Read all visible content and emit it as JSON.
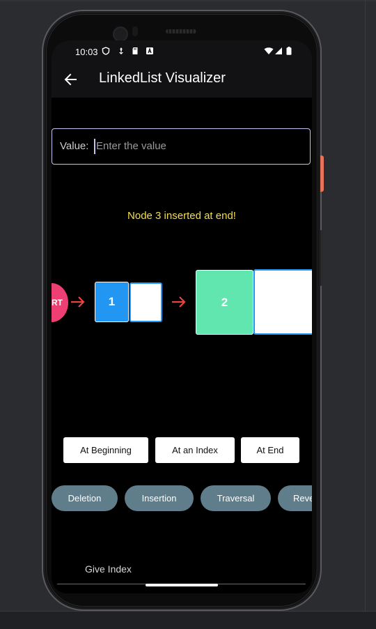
{
  "statusbar": {
    "time": "10:03"
  },
  "appbar": {
    "title": "LinkedList Visualizer"
  },
  "value_input": {
    "label": "Value:",
    "placeholder": "Enter the value"
  },
  "status_message": "Node 3 inserted at end!",
  "linked_list": {
    "start_label": "RT",
    "nodes": [
      {
        "value": "1"
      },
      {
        "value": "2"
      }
    ]
  },
  "insert_buttons": {
    "at_beginning": "At Beginning",
    "at_index": "At an Index",
    "at_end": "At End"
  },
  "operation_chips": [
    {
      "label": "Deletion"
    },
    {
      "label": "Insertion"
    },
    {
      "label": "Traversal"
    },
    {
      "label": "Reve"
    }
  ],
  "index_input": {
    "placeholder": "Give Index"
  },
  "colors": {
    "accent_field_border": "#c9c2f0",
    "status_text": "#f4dd53",
    "start_node": "#ee3f73",
    "node1_fill": "#2196f3",
    "node2_fill": "#62e6b0",
    "arrow": "#e8453c",
    "chip": "#607d8b"
  }
}
